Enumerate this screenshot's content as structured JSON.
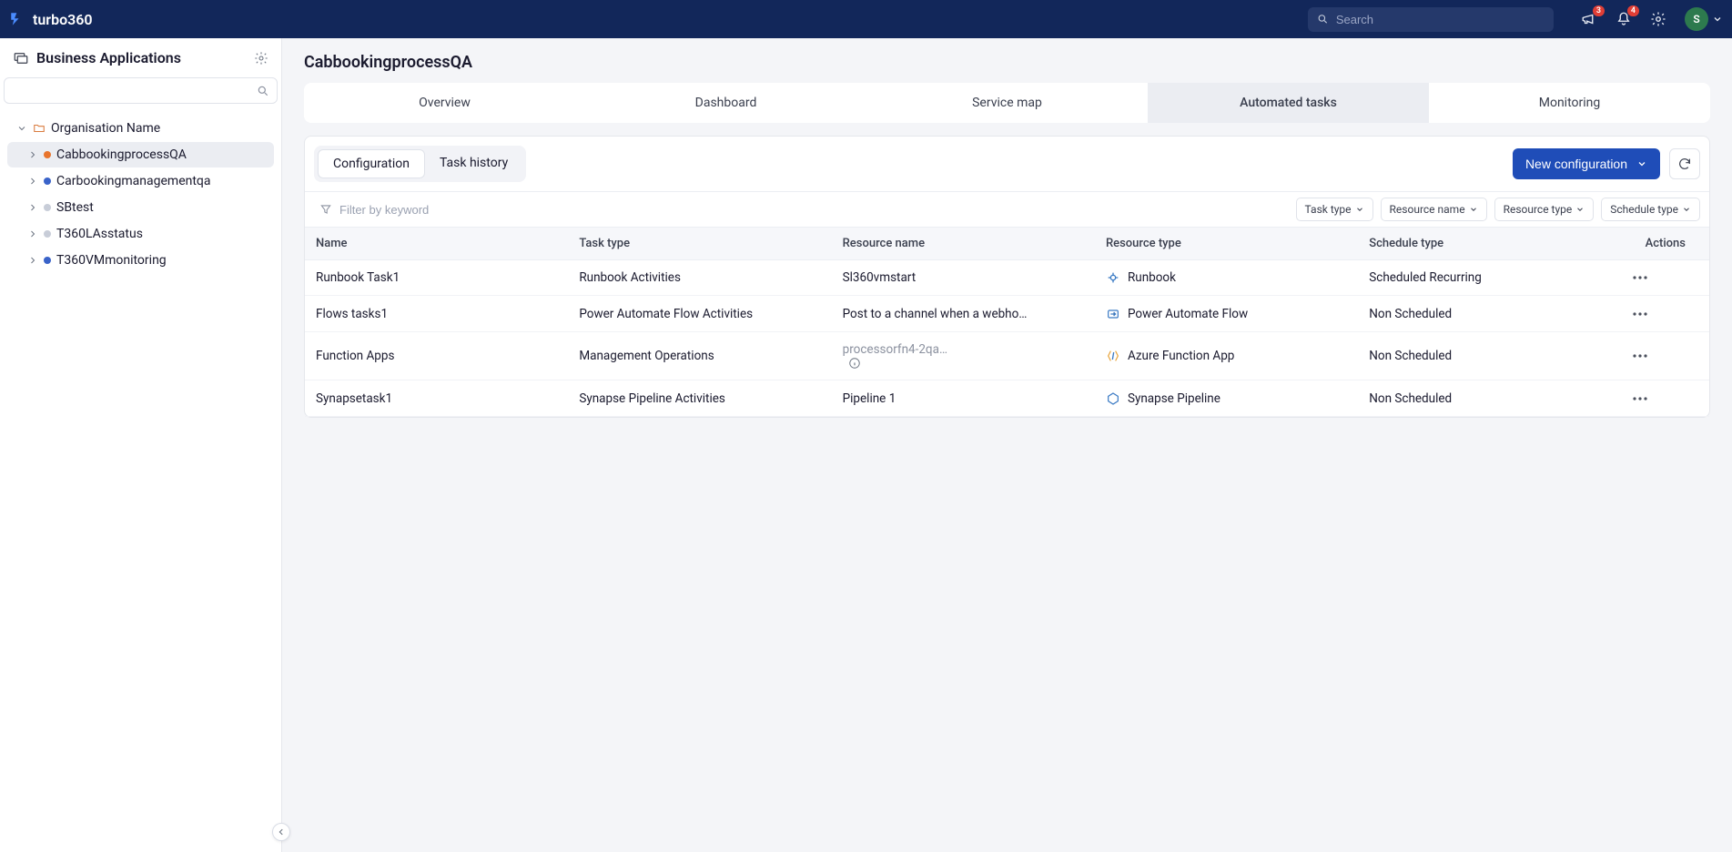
{
  "brand": "turbo360",
  "topbar": {
    "search_placeholder": "Search",
    "megaphone_badge": "3",
    "bell_badge": "4",
    "avatar_initial": "S"
  },
  "sidebar": {
    "title": "Business Applications",
    "root": {
      "label": "Organisation Name"
    },
    "items": [
      {
        "label": "CabbookingprocessQA",
        "dot": "orange",
        "active": true
      },
      {
        "label": "Carbookingmanagementqa",
        "dot": "blue",
        "active": false
      },
      {
        "label": "SBtest",
        "dot": "gray",
        "active": false
      },
      {
        "label": "T360LAsstatus",
        "dot": "gray",
        "active": false
      },
      {
        "label": "T360VMmonitoring",
        "dot": "blue",
        "active": false
      }
    ]
  },
  "page": {
    "title": "CabbookingprocessQA",
    "tabs": [
      {
        "label": "Overview"
      },
      {
        "label": "Dashboard"
      },
      {
        "label": "Service map"
      },
      {
        "label": "Automated tasks",
        "active": true
      },
      {
        "label": "Monitoring"
      }
    ],
    "subtabs": [
      {
        "label": "Configuration",
        "active": true
      },
      {
        "label": "Task history"
      }
    ],
    "new_config_label": "New configuration",
    "filter_placeholder": "Filter by keyword",
    "filter_chips": [
      {
        "label": "Task type"
      },
      {
        "label": "Resource name"
      },
      {
        "label": "Resource type"
      },
      {
        "label": "Schedule type"
      }
    ],
    "columns": {
      "name": "Name",
      "task_type": "Task type",
      "resource_name": "Resource name",
      "resource_type": "Resource type",
      "schedule_type": "Schedule type",
      "actions": "Actions"
    },
    "rows": [
      {
        "name": "Runbook Task1",
        "task_type": "Runbook Activities",
        "resource_name": "Sl360vmstart",
        "resource_type": "Runbook",
        "rt_icon": "runbook",
        "schedule": "Scheduled Recurring"
      },
      {
        "name": "Flows tasks1",
        "task_type": "Power Automate Flow Activities",
        "resource_name": "Post to a channel when a webhook …",
        "resource_type": "Power Automate Flow",
        "rt_icon": "flow",
        "schedule": "Non Scheduled"
      },
      {
        "name": "Function Apps",
        "task_type": "Management Operations",
        "resource_name": "processorfn4-2qa…",
        "resource_muted": true,
        "info": true,
        "resource_type": "Azure Function App",
        "rt_icon": "function",
        "schedule": "Non Scheduled"
      },
      {
        "name": "Synapsetask1",
        "task_type": "Synapse Pipeline Activities",
        "resource_name": "Pipeline 1",
        "resource_type": "Synapse Pipeline",
        "rt_icon": "synapse",
        "schedule": "Non Scheduled"
      }
    ]
  }
}
